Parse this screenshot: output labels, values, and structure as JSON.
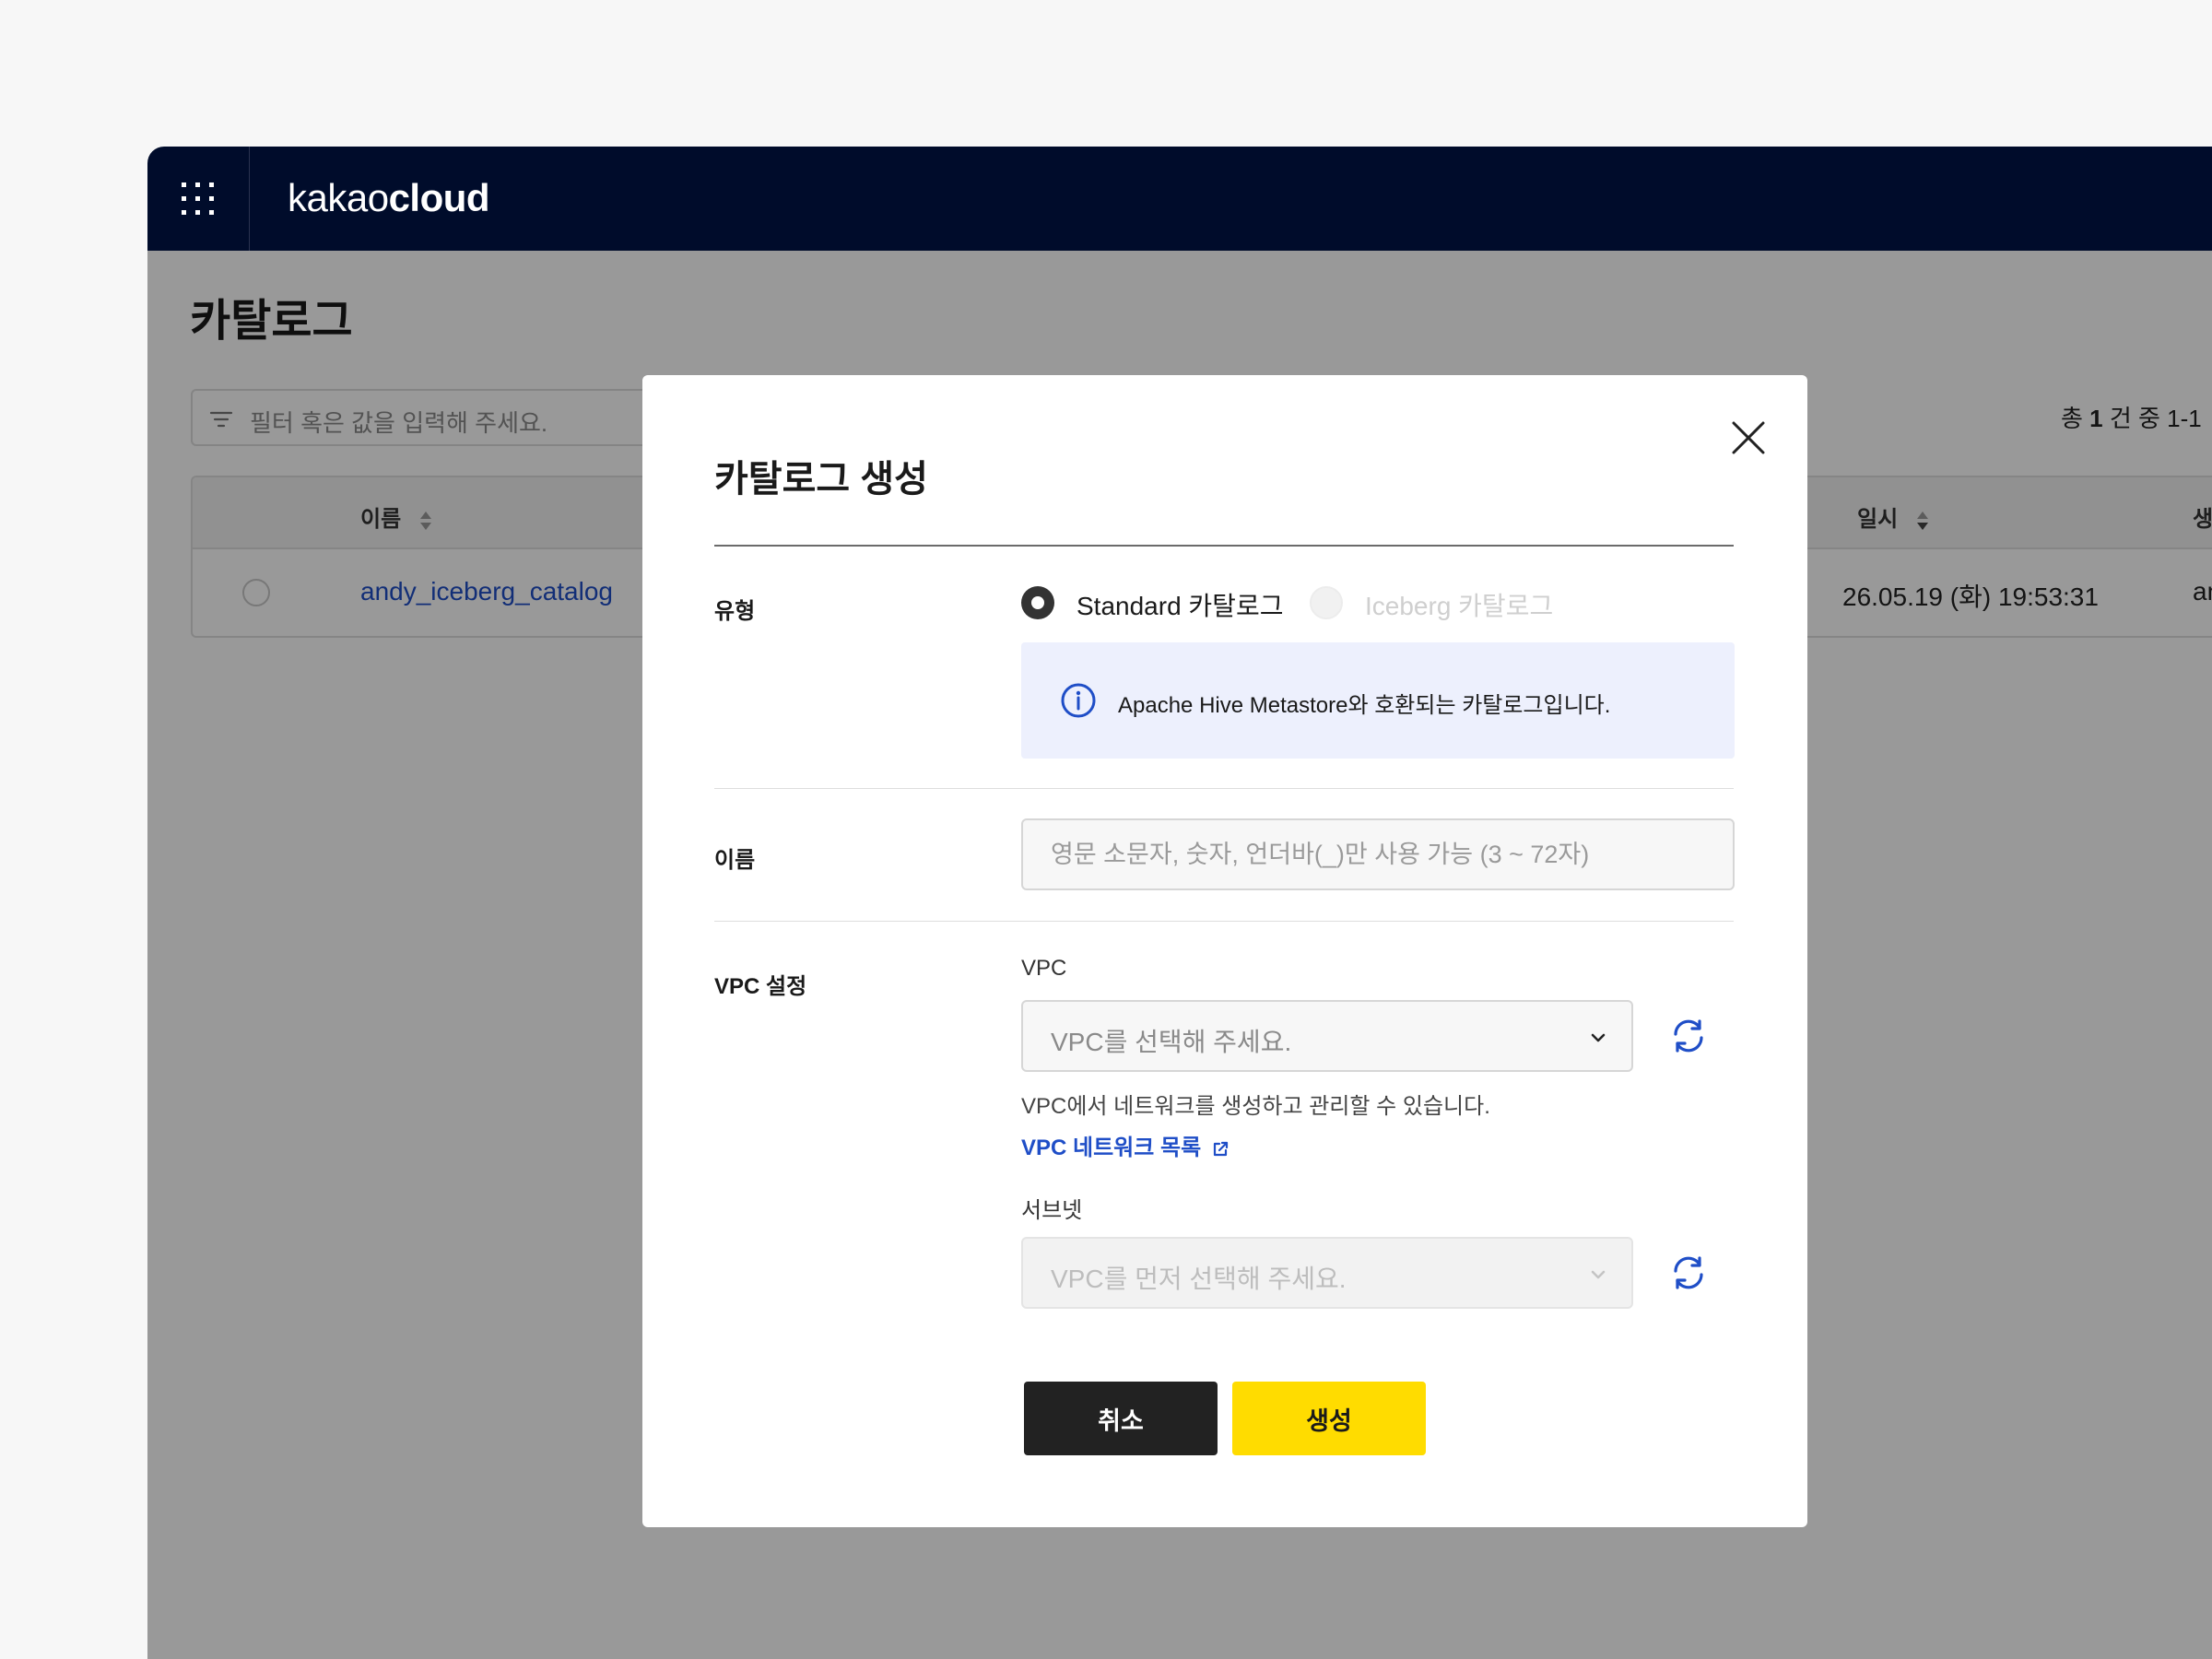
{
  "app": {
    "logo_part1": "kakao",
    "logo_part2": "cloud"
  },
  "page": {
    "title": "카탈로그",
    "filter_placeholder": "필터 혹은 값을 입력해 주세요.",
    "total_prefix": "총",
    "total_count": "1",
    "total_suffix": "건  중 1-1"
  },
  "table": {
    "columns": {
      "name": "이름",
      "date": "일시",
      "creator": "생성자"
    },
    "rows": [
      {
        "name": "andy_iceberg_catalog",
        "date": "26.05.19 (화) 19:53:31",
        "creator": "andre"
      }
    ]
  },
  "modal": {
    "title": "카탈로그 생성",
    "type_label": "유형",
    "type_options": [
      {
        "label": "Standard 카탈로그",
        "selected": true,
        "disabled": false
      },
      {
        "label": "Iceberg 카탈로그",
        "selected": false,
        "disabled": true
      }
    ],
    "info_text": "Apache Hive Metastore와 호환되는 카탈로그입니다.",
    "name_label": "이름",
    "name_value": "",
    "name_placeholder": "영문 소문자, 숫자, 언더바(_)만 사용 가능 (3 ~ 72자)",
    "vpc_section_label": "VPC 설정",
    "vpc_label": "VPC",
    "vpc_select_value": "VPC를 선택해 주세요.",
    "vpc_help": "VPC에서 네트워크를 생성하고 관리할 수 있습니다.",
    "vpc_link": "VPC 네트워크 목록",
    "subnet_label": "서브넷",
    "subnet_select_value": "VPC를 먼저 선택해 주세요.",
    "cancel_label": "취소",
    "create_label": "생성"
  },
  "colors": {
    "topbar": "#000c2b",
    "accent_blue": "#1f4ec7",
    "create_button": "#ffdc00",
    "cancel_button": "#222222",
    "info_bg": "#edf0fd"
  },
  "icons": [
    "apps-grid-icon",
    "filter-icon",
    "sort-icon",
    "close-icon",
    "info-icon",
    "chevron-down-icon",
    "refresh-icon",
    "external-link-icon"
  ]
}
